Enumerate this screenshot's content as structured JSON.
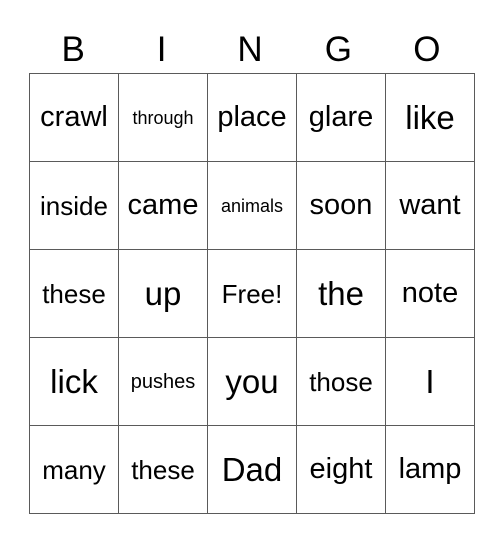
{
  "header": [
    "B",
    "I",
    "N",
    "G",
    "O"
  ],
  "rows": [
    [
      {
        "w": "crawl",
        "s": "s2"
      },
      {
        "w": "through",
        "s": "s5"
      },
      {
        "w": "place",
        "s": "s2"
      },
      {
        "w": "glare",
        "s": "s2"
      },
      {
        "w": "like",
        "s": "s1"
      }
    ],
    [
      {
        "w": "inside",
        "s": "s3"
      },
      {
        "w": "came",
        "s": "s2"
      },
      {
        "w": "animals",
        "s": "s5"
      },
      {
        "w": "soon",
        "s": "s2"
      },
      {
        "w": "want",
        "s": "s2"
      }
    ],
    [
      {
        "w": "these",
        "s": "s3"
      },
      {
        "w": "up",
        "s": "s1"
      },
      {
        "w": "Free!",
        "s": "s3"
      },
      {
        "w": "the",
        "s": "s1"
      },
      {
        "w": "note",
        "s": "s2"
      }
    ],
    [
      {
        "w": "lick",
        "s": "s1"
      },
      {
        "w": "pushes",
        "s": "s4"
      },
      {
        "w": "you",
        "s": "s1"
      },
      {
        "w": "those",
        "s": "s3"
      },
      {
        "w": "I",
        "s": "s1"
      }
    ],
    [
      {
        "w": "many",
        "s": "s3"
      },
      {
        "w": "these",
        "s": "s3"
      },
      {
        "w": "Dad",
        "s": "s1"
      },
      {
        "w": "eight",
        "s": "s2"
      },
      {
        "w": "lamp",
        "s": "s2"
      }
    ]
  ]
}
